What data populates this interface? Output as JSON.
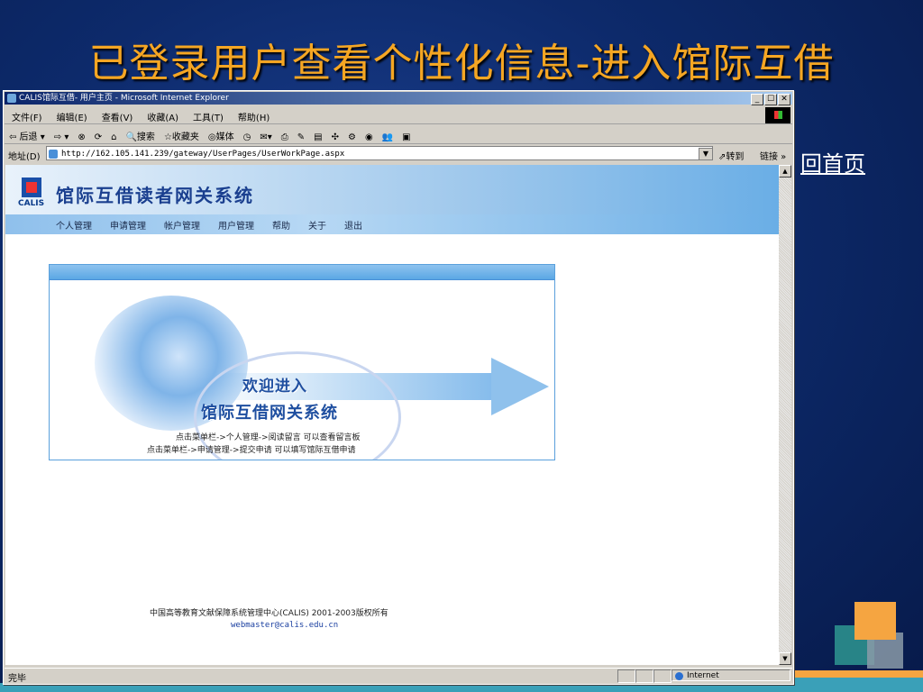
{
  "slide": {
    "title": "已登录用户查看个性化信息-进入馆际互借",
    "home_link": "回首页"
  },
  "browser": {
    "window_title": "CALIS馆际互借- 用户主页 - Microsoft Internet Explorer",
    "window_buttons": [
      "_",
      "☐",
      "✕"
    ],
    "menu": [
      "文件(F)",
      "编辑(E)",
      "查看(V)",
      "收藏(A)",
      "工具(T)",
      "帮助(H)"
    ],
    "toolbar": [
      "⇦ 后退 ▾",
      "⇨ ▾",
      "⊗",
      "⟳",
      "⌂",
      "🔍搜索",
      "☆收藏夹",
      "◎媒体",
      "◷",
      "✉▾",
      "⎙",
      "✎",
      "▤",
      "✣",
      "⚙",
      "◉",
      "👥",
      "▣"
    ],
    "address_label": "地址(D)",
    "address_value": "http://162.105.141.239/gateway/UserPages/UserWorkPage.aspx",
    "go_label": "⇗转到",
    "links_label": "链接 »",
    "status_text": "完毕",
    "status_zone": "Internet"
  },
  "page": {
    "logo_text": "CALIS",
    "banner_title": "馆际互借读者网关系统",
    "nav": [
      "个人管理",
      "申请管理",
      "帐户管理",
      "用户管理",
      "帮助",
      "关于",
      "退出"
    ],
    "welcome_line1": "欢迎进入",
    "welcome_line2": "馆际互借网关系统",
    "hint1": "点击菜单栏->个人管理->阅读留言 可以查看留言板",
    "hint2": "点击菜单栏->申请管理->提交申请 可以填写馆际互借申请",
    "footer_copyright": "中国高等教育文献保障系统管理中心(CALIS) 2001-2003版权所有",
    "footer_email": "webmaster@calis.edu.cn"
  },
  "colors": {
    "title_orange": "#f5a623",
    "background_blue": "#0d2a6b",
    "ie_gray": "#d4d0c8",
    "banner_blue": "#6aaee6"
  }
}
